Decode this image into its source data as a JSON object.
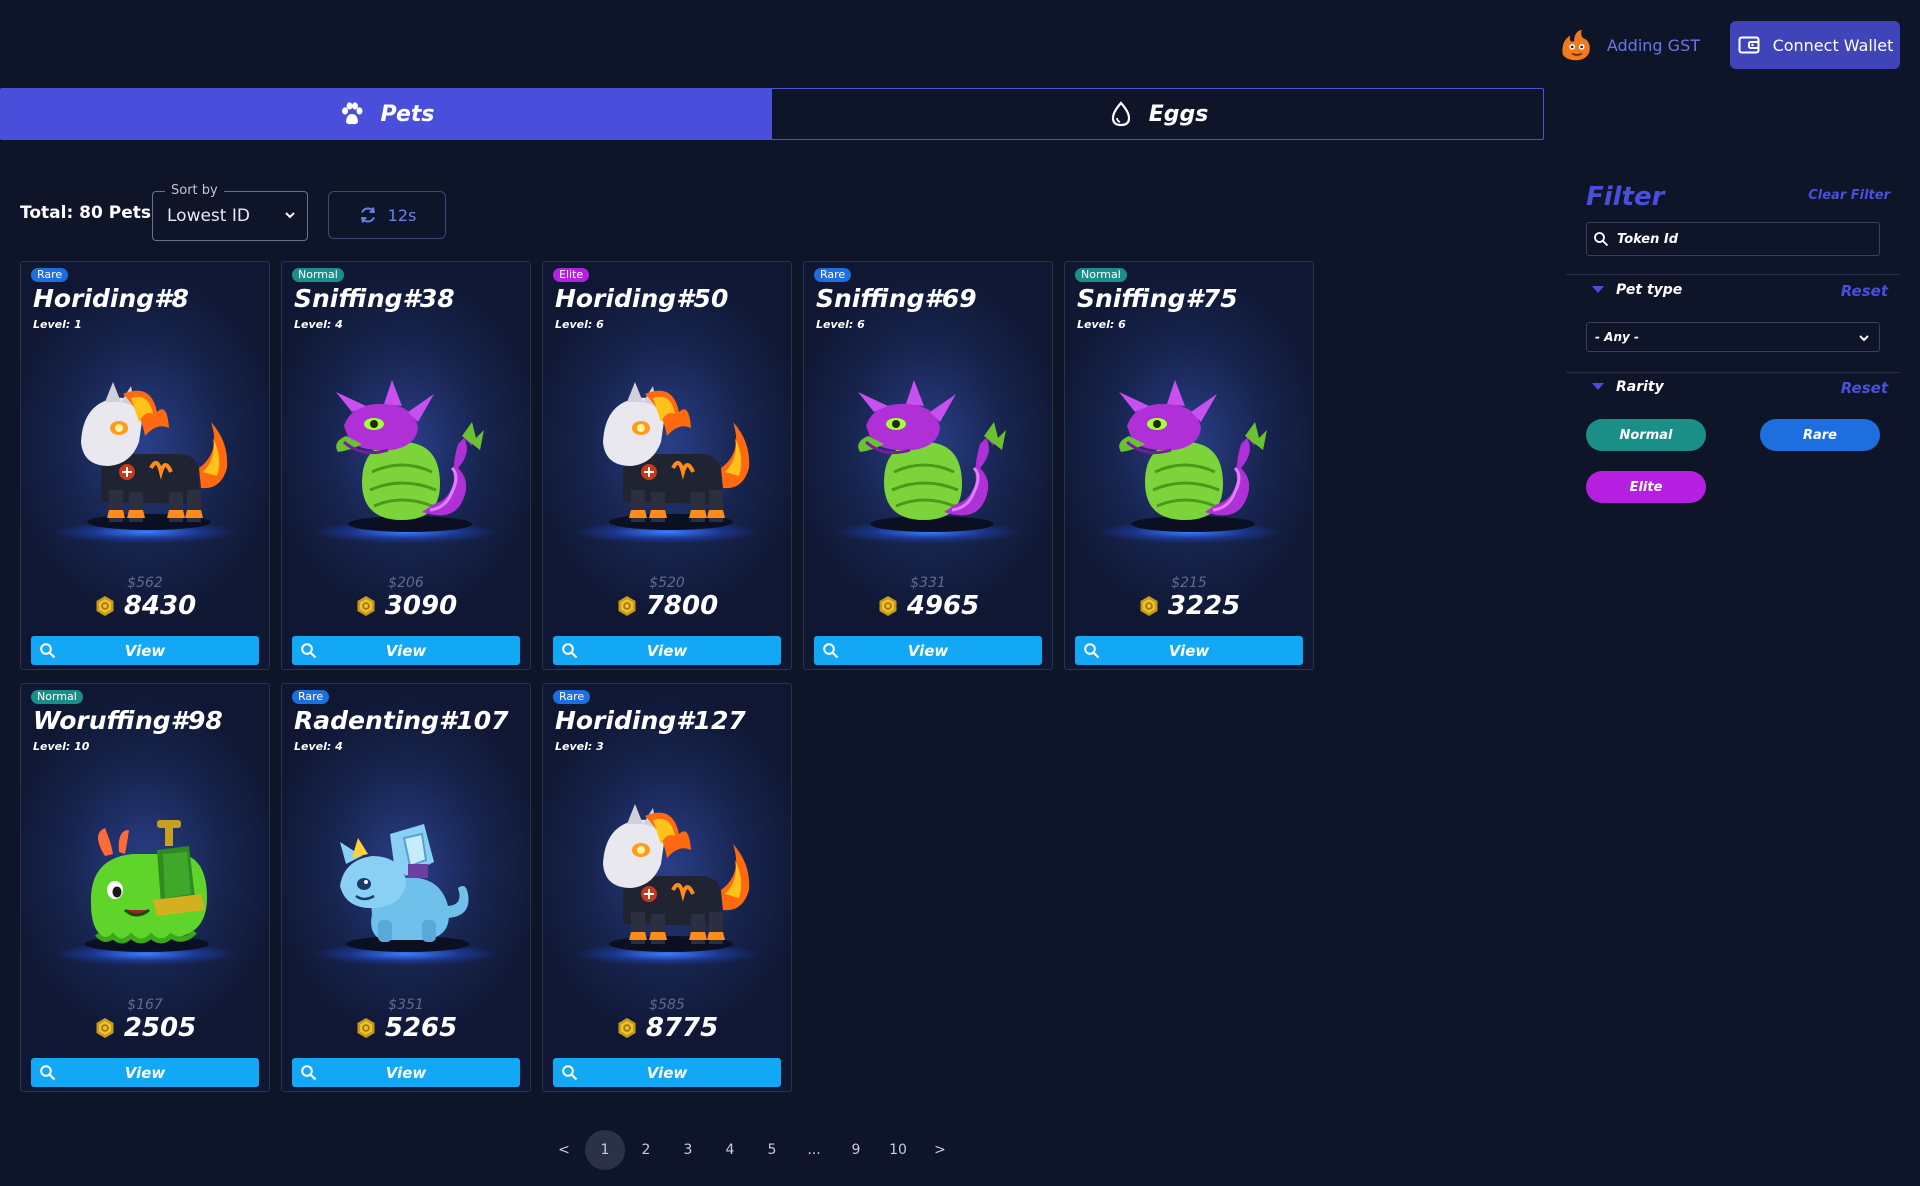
{
  "header": {
    "adding_label": "Adding GST",
    "connect_wallet_label": "Connect Wallet"
  },
  "tabs": [
    {
      "label": "Pets",
      "active": true,
      "icon": "paw-icon"
    },
    {
      "label": "Eggs",
      "active": false,
      "icon": "egg-icon"
    }
  ],
  "toolbar": {
    "total_label": "Total: 80 Pets",
    "sort_label": "Sort by",
    "sort_value": "Lowest ID",
    "refresh_label": "12s"
  },
  "cards": [
    {
      "rarity": "Rare",
      "name": "Horiding#8",
      "level": "Level: 1",
      "usd": "$562",
      "price": "8430",
      "view_label": "View",
      "pet": "horse"
    },
    {
      "rarity": "Normal",
      "name": "Sniffing#38",
      "level": "Level: 4",
      "usd": "$206",
      "price": "3090",
      "view_label": "View",
      "pet": "dragon"
    },
    {
      "rarity": "Elite",
      "name": "Horiding#50",
      "level": "Level: 6",
      "usd": "$520",
      "price": "7800",
      "view_label": "View",
      "pet": "horse"
    },
    {
      "rarity": "Rare",
      "name": "Sniffing#69",
      "level": "Level: 6",
      "usd": "$331",
      "price": "4965",
      "view_label": "View",
      "pet": "dragon"
    },
    {
      "rarity": "Normal",
      "name": "Sniffing#75",
      "level": "Level: 6",
      "usd": "$215",
      "price": "3225",
      "view_label": "View",
      "pet": "dragon"
    },
    {
      "rarity": "Normal",
      "name": "Woruffing#98",
      "level": "Level: 10",
      "usd": "$167",
      "price": "2505",
      "view_label": "View",
      "pet": "slime"
    },
    {
      "rarity": "Rare",
      "name": "Radenting#107",
      "level": "Level: 4",
      "usd": "$351",
      "price": "5265",
      "view_label": "View",
      "pet": "cat"
    },
    {
      "rarity": "Rare",
      "name": "Horiding#127",
      "level": "Level: 3",
      "usd": "$585",
      "price": "8775",
      "view_label": "View",
      "pet": "horse"
    }
  ],
  "pagination": [
    "<",
    "1",
    "2",
    "3",
    "4",
    "5",
    "...",
    "9",
    "10",
    ">"
  ],
  "pagination_active": "1",
  "filter": {
    "title": "Filter",
    "clear_label": "Clear Filter",
    "token_placeholder": "Token Id",
    "pet_type_label": "Pet type",
    "pet_type_reset": "Reset",
    "pet_type_value": "- Any -",
    "rarity_label": "Rarity",
    "rarity_reset": "Reset",
    "rarity_options": [
      "Normal",
      "Rare",
      "Elite"
    ]
  },
  "colors": {
    "background": "#0f1529",
    "accent": "#4a4fdb",
    "view_button": "#12a8f5",
    "rare": "#1d6fe0",
    "normal": "#1a8f87",
    "elite": "#b41fe0"
  }
}
